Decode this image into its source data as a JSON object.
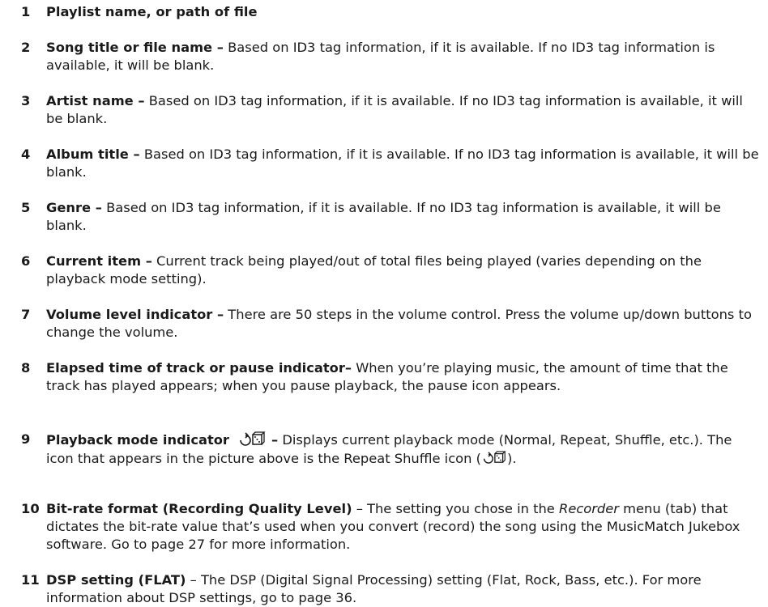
{
  "items": [
    {
      "num": "1",
      "term": "Playlist name, or path of file",
      "desc": ""
    },
    {
      "num": "2",
      "term": "Song title or file name –",
      "desc": " Based on ID3 tag information, if it is available. If no ID3 tag information is available, it will be blank."
    },
    {
      "num": "3",
      "term": "Artist name –",
      "desc": "  Based on ID3 tag information, if it is available. If no ID3 tag information is available, it will be blank."
    },
    {
      "num": "4",
      "term": "Album title –",
      "desc": "  Based on ID3 tag information, if it is available. If no ID3 tag information is available, it will be blank."
    },
    {
      "num": "5",
      "term": "Genre –",
      "desc": " Based on ID3 tag information, if it is available. If no ID3 tag information is available, it will be blank."
    },
    {
      "num": "6",
      "term": "Current item –",
      "desc": " Current track being played/out of total files being played (varies depending on the playback mode setting)."
    },
    {
      "num": "7",
      "term": "Volume level indicator –",
      "desc": "  There are 50 steps in the volume control. Press the volume up/down buttons to change the volume."
    },
    {
      "num": "8",
      "term": "Elapsed time of track or pause indicator–",
      "desc": " When you’re playing music, the amount of time that the track has played appears; when you pause playback, the pause icon appears."
    },
    {
      "num": "9",
      "term": "Playback mode indicator",
      "term_suffix": " –",
      "desc_a": " Displays current playback mode (Normal, Repeat, Shuffle, etc.). The icon that appears in the picture above is the Repeat Shuffle icon (",
      "desc_b": ")."
    },
    {
      "num": "10",
      "term": "Bit-rate format (Recording Quality Level)",
      "desc_a": "  –  The setting you chose in the ",
      "desc_em": "Recorder",
      "desc_b": " menu (tab) that dictates the bit-rate value that’s used when you convert (record) the song using the MusicMatch Jukebox software. Go to page 27 for more information."
    },
    {
      "num": "11",
      "term": "DSP setting (FLAT)",
      "desc": "  –  The DSP (Digital Signal Processing) setting (Flat, Rock, Bass, etc.). For more information about DSP settings, go to page 36."
    }
  ],
  "icons": {
    "repeat_shuffle": "repeat-shuffle-icon"
  }
}
